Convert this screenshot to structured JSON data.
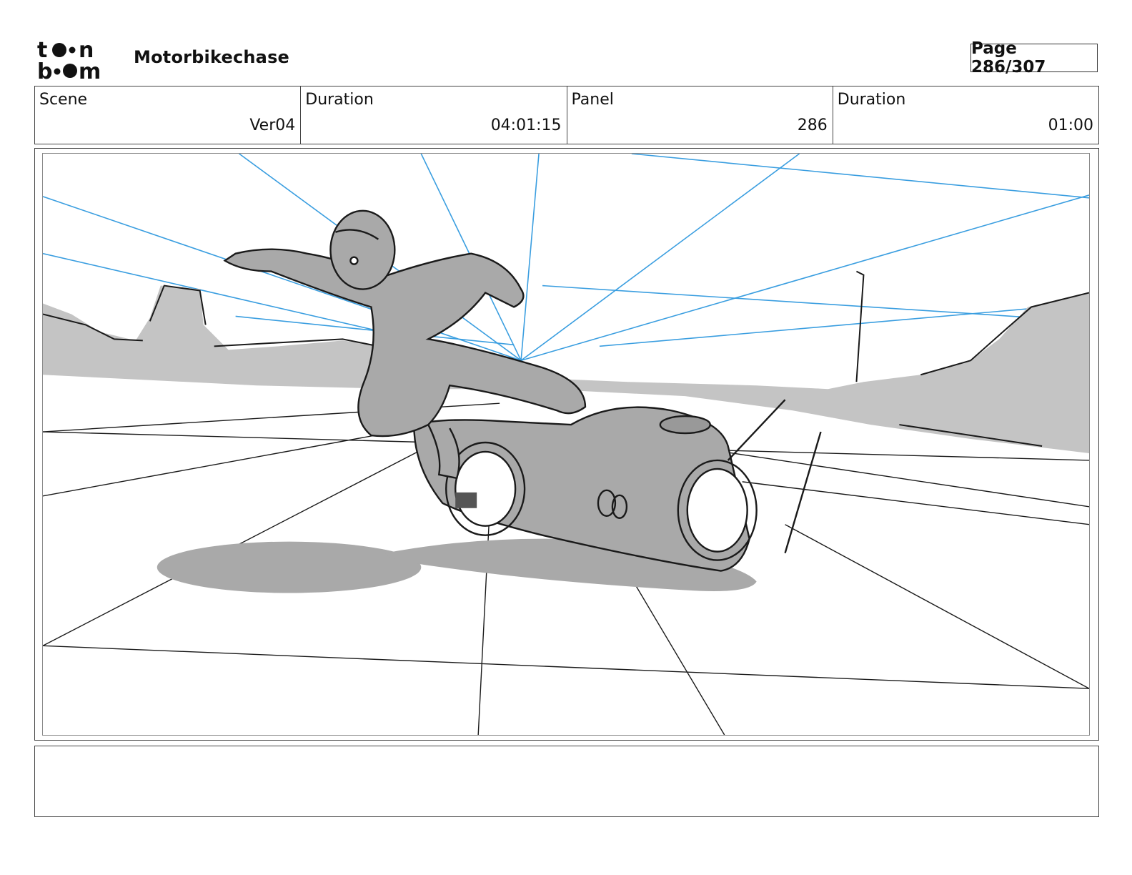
{
  "header": {
    "logo_line1": "to•n",
    "logo_line2": "b•om",
    "project_title": "Motorbikechase",
    "page_label": "Page 286/307"
  },
  "info": [
    {
      "label": "Scene",
      "value": "Ver04"
    },
    {
      "label": "Duration",
      "value": "04:01:15"
    },
    {
      "label": "Panel",
      "value": "286"
    },
    {
      "label": "Duration",
      "value": "01:00"
    }
  ],
  "panel": {
    "description": "",
    "colors": {
      "guide_lines": "#3a9ee0",
      "shading": "#a9a9a9",
      "ink": "#1a1a1a"
    }
  },
  "notes": {
    "text": ""
  }
}
